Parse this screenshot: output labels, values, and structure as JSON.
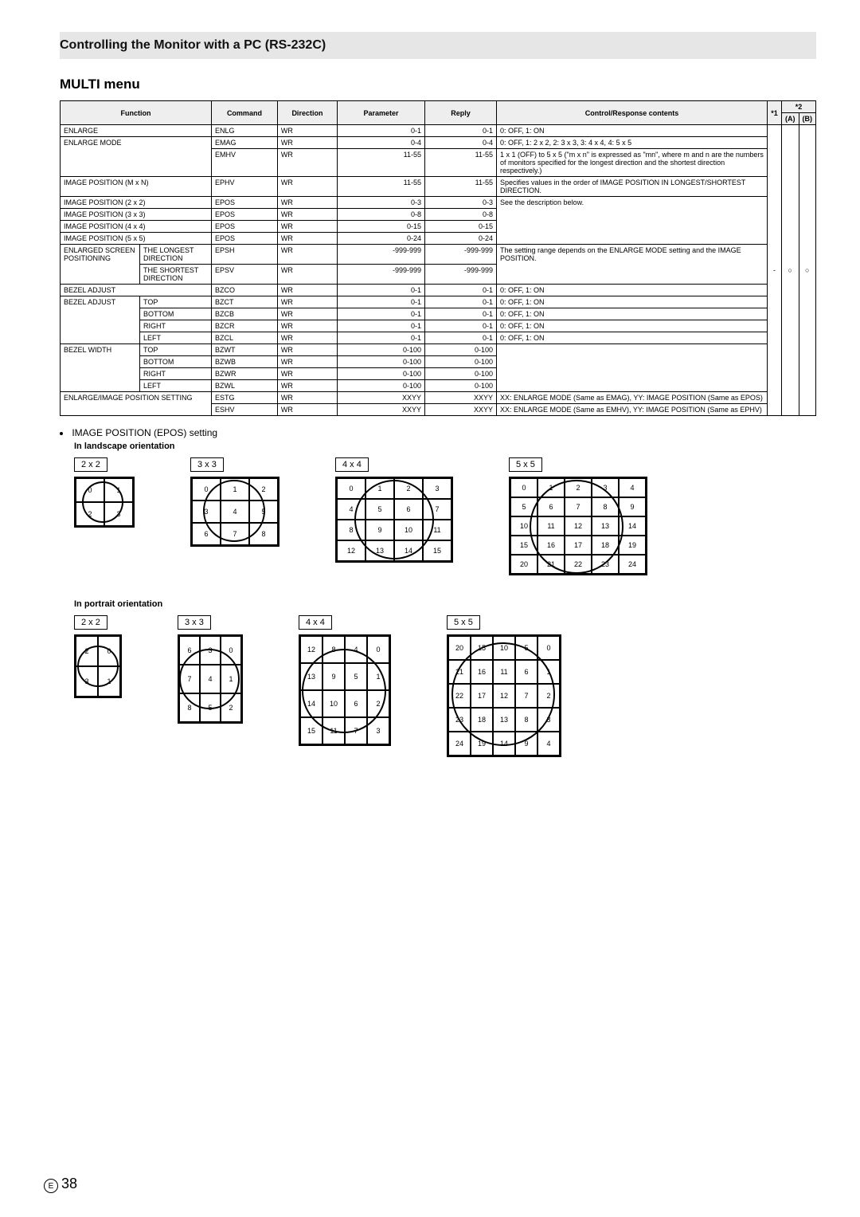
{
  "header": {
    "title": "Controlling the Monitor with a PC (RS-232C)"
  },
  "section": {
    "title": "MULTI menu"
  },
  "table": {
    "headers": {
      "function": "Function",
      "command": "Command",
      "direction": "Direction",
      "parameter": "Parameter",
      "reply": "Reply",
      "contents": "Control/Response contents",
      "s1": "*1",
      "s2": "*2",
      "s2a": "(A)",
      "s2b": "(B)"
    },
    "rows": [
      {
        "func": "ENLARGE",
        "sub": "",
        "cmd": "ENLG",
        "dir": "WR",
        "param": "0-1",
        "reply": "0-1",
        "desc": "0: OFF, 1: ON",
        "rs1": 1
      },
      {
        "func": "ENLARGE MODE",
        "sub": "",
        "cmd": "EMAG",
        "dir": "WR",
        "param": "0-4",
        "reply": "0-4",
        "desc": "0: OFF, 1: 2 x 2, 2: 3 x 3, 3: 4 x 4, 4: 5 x 5",
        "rs1": 2
      },
      {
        "func": "",
        "sub": "",
        "cmd": "EMHV",
        "dir": "WR",
        "param": "11-55",
        "reply": "11-55",
        "desc": "1 x 1 (OFF) to 5 x 5 (\"m x n\" is expressed as \"mn\", where m and n are the numbers of monitors specified for the longest direction and the shortest direction respectively.)"
      },
      {
        "func": "IMAGE POSITION (M x N)",
        "sub": "",
        "cmd": "EPHV",
        "dir": "WR",
        "param": "11-55",
        "reply": "11-55",
        "desc": "Specifies values in the order of IMAGE POSITION IN LONGEST/SHORTEST DIRECTION.",
        "rs1": 1
      },
      {
        "func": "IMAGE POSITION (2 x 2)",
        "sub": "",
        "cmd": "EPOS",
        "dir": "WR",
        "param": "0-3",
        "reply": "0-3",
        "desc": "See the description below.",
        "rs1": 1,
        "descspan": 4
      },
      {
        "func": "IMAGE POSITION (3 x 3)",
        "sub": "",
        "cmd": "EPOS",
        "dir": "WR",
        "param": "0-8",
        "reply": "0-8",
        "rs1": 1
      },
      {
        "func": "IMAGE POSITION (4 x 4)",
        "sub": "",
        "cmd": "EPOS",
        "dir": "WR",
        "param": "0-15",
        "reply": "0-15",
        "rs1": 1
      },
      {
        "func": "IMAGE POSITION (5 x 5)",
        "sub": "",
        "cmd": "EPOS",
        "dir": "WR",
        "param": "0-24",
        "reply": "0-24",
        "rs1": 1
      },
      {
        "func": "ENLARGED SCREEN POSITIONING",
        "sub": "THE LONGEST DIRECTION",
        "cmd": "EPSH",
        "dir": "WR",
        "param": "-999-999",
        "reply": "-999-999",
        "desc": "The setting range depends on the ENLARGE MODE setting and the IMAGE POSITION.",
        "rs1": 2,
        "descspan": 2
      },
      {
        "func": "",
        "sub": "THE SHORTEST DIRECTION",
        "cmd": "EPSV",
        "dir": "WR",
        "param": "-999-999",
        "reply": "-999-999"
      },
      {
        "func": "BEZEL ADJUST",
        "sub": "",
        "cmd": "BZCO",
        "dir": "WR",
        "param": "0-1",
        "reply": "0-1",
        "desc": "0: OFF, 1: ON",
        "rs1": 1
      },
      {
        "func": "BEZEL ADJUST",
        "sub": "TOP",
        "cmd": "BZCT",
        "dir": "WR",
        "param": "0-1",
        "reply": "0-1",
        "desc": "0: OFF, 1: ON",
        "rs1": 4
      },
      {
        "func": "",
        "sub": "BOTTOM",
        "cmd": "BZCB",
        "dir": "WR",
        "param": "0-1",
        "reply": "0-1",
        "desc": "0: OFF, 1: ON"
      },
      {
        "func": "",
        "sub": "RIGHT",
        "cmd": "BZCR",
        "dir": "WR",
        "param": "0-1",
        "reply": "0-1",
        "desc": "0: OFF, 1: ON"
      },
      {
        "func": "",
        "sub": "LEFT",
        "cmd": "BZCL",
        "dir": "WR",
        "param": "0-1",
        "reply": "0-1",
        "desc": "0: OFF, 1: ON"
      },
      {
        "func": "BEZEL WIDTH",
        "sub": "TOP",
        "cmd": "BZWT",
        "dir": "WR",
        "param": "0-100",
        "reply": "0-100",
        "desc": "",
        "rs1": 4,
        "descspan": 4
      },
      {
        "func": "",
        "sub": "BOTTOM",
        "cmd": "BZWB",
        "dir": "WR",
        "param": "0-100",
        "reply": "0-100"
      },
      {
        "func": "",
        "sub": "RIGHT",
        "cmd": "BZWR",
        "dir": "WR",
        "param": "0-100",
        "reply": "0-100"
      },
      {
        "func": "",
        "sub": "LEFT",
        "cmd": "BZWL",
        "dir": "WR",
        "param": "0-100",
        "reply": "0-100"
      },
      {
        "func": "ENLARGE/IMAGE POSITION SETTING",
        "sub": "",
        "cmd": "ESTG",
        "dir": "WR",
        "param": "XXYY",
        "reply": "XXYY",
        "desc": "XX: ENLARGE MODE (Same as EMAG), YY: IMAGE POSITION (Same as EPOS)",
        "rs1": 2
      },
      {
        "func": "",
        "sub": "",
        "cmd": "ESHV",
        "dir": "WR",
        "param": "XXYY",
        "reply": "XXYY",
        "desc": "XX: ENLARGE MODE (Same as EMHV), YY: IMAGE POSITION (Same as EPHV)"
      }
    ],
    "trail": {
      "s1": "-",
      "s2a": "○",
      "s2b": "○"
    }
  },
  "bullet": {
    "text": "IMAGE POSITION (EPOS) setting"
  },
  "landscape": {
    "heading": "In landscape orientation",
    "labels": {
      "l2": "2 x 2",
      "l3": "3 x 3",
      "l4": "4 x 4",
      "l5": "5 x 5"
    },
    "g2": [
      "0",
      "1",
      "2",
      "3"
    ],
    "g3": [
      "0",
      "1",
      "2",
      "3",
      "4",
      "5",
      "6",
      "7",
      "8"
    ],
    "g4": [
      "0",
      "1",
      "2",
      "3",
      "4",
      "5",
      "6",
      "7",
      "8",
      "9",
      "10",
      "11",
      "12",
      "13",
      "14",
      "15"
    ],
    "g5": [
      "0",
      "1",
      "2",
      "3",
      "4",
      "5",
      "6",
      "7",
      "8",
      "9",
      "10",
      "11",
      "12",
      "13",
      "14",
      "15",
      "16",
      "17",
      "18",
      "19",
      "20",
      "21",
      "22",
      "23",
      "24"
    ]
  },
  "portrait": {
    "heading": "In portrait orientation",
    "labels": {
      "l2": "2 x 2",
      "l3": "3 x 3",
      "l4": "4 x 4",
      "l5": "5 x 5"
    },
    "g2": [
      "2",
      "0",
      "3",
      "1"
    ],
    "g3": [
      "6",
      "3",
      "0",
      "7",
      "4",
      "1",
      "8",
      "5",
      "2"
    ],
    "g4": [
      "12",
      "8",
      "4",
      "0",
      "13",
      "9",
      "5",
      "1",
      "14",
      "10",
      "6",
      "2",
      "15",
      "11",
      "7",
      "3"
    ],
    "g5": [
      "20",
      "15",
      "10",
      "5",
      "0",
      "21",
      "16",
      "11",
      "6",
      "1",
      "22",
      "17",
      "12",
      "7",
      "2",
      "23",
      "18",
      "13",
      "8",
      "3",
      "24",
      "19",
      "14",
      "9",
      "4"
    ]
  },
  "pageNum": {
    "e": "E",
    "num": "38"
  }
}
